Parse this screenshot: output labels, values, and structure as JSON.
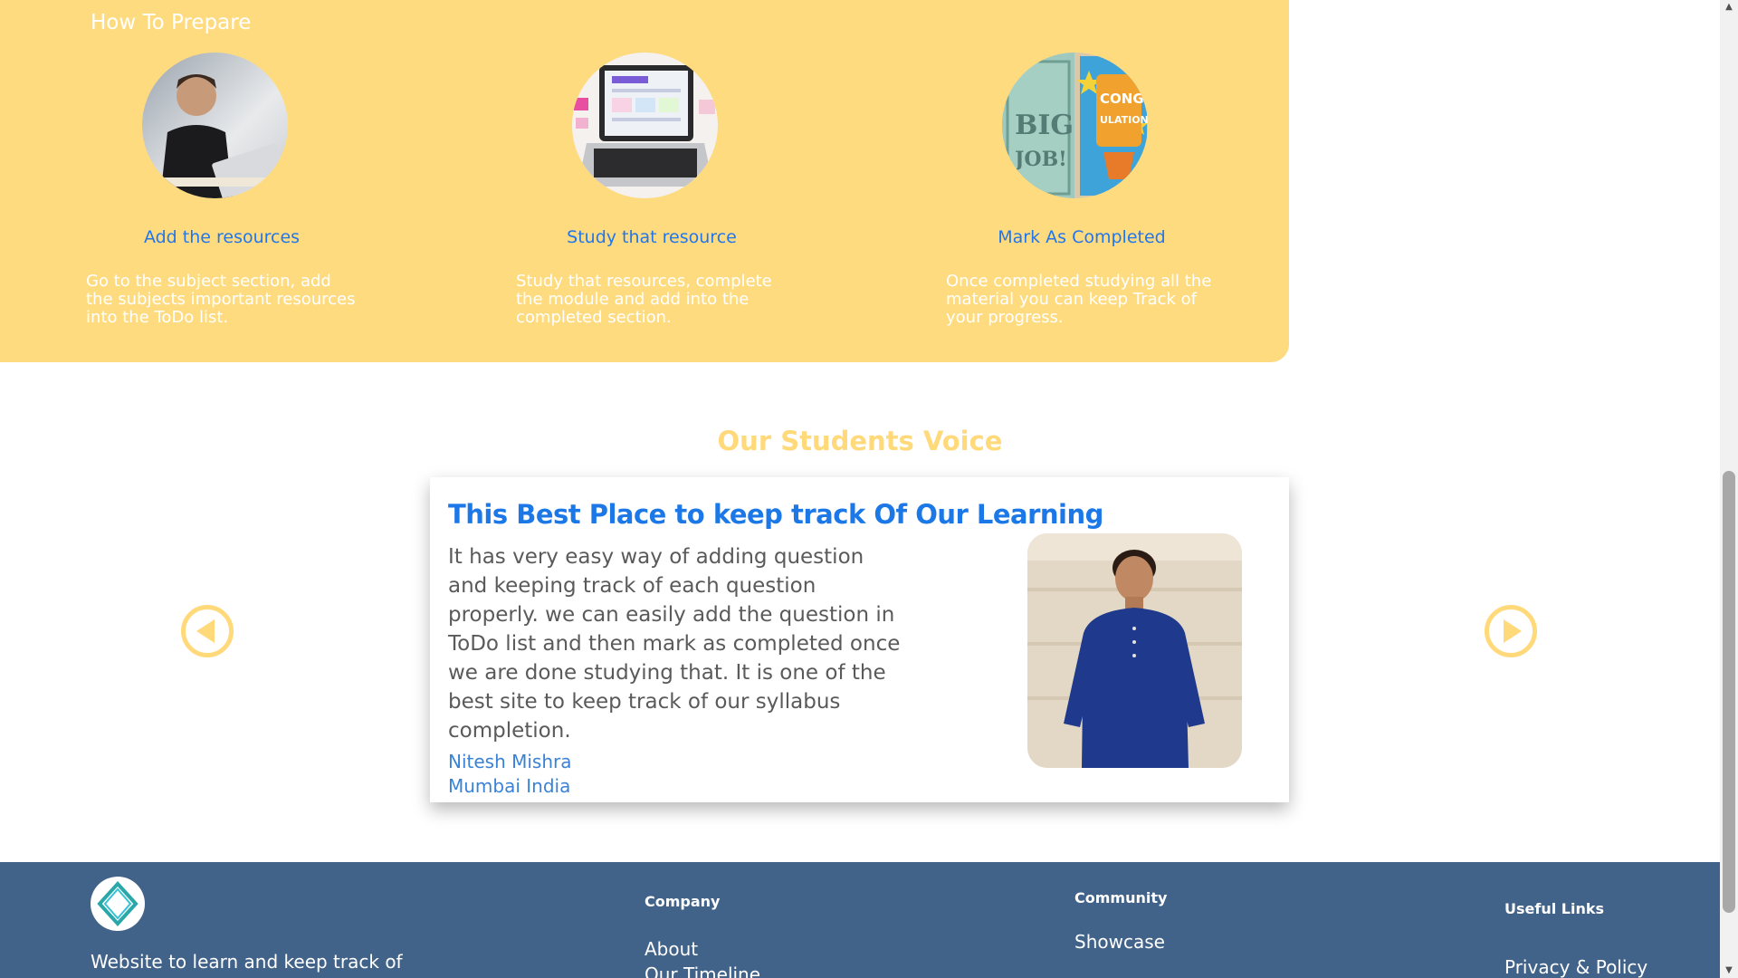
{
  "prepare": {
    "title": "How To Prepare",
    "steps": [
      {
        "title": "Add the resources",
        "text": "Go to the subject section, add the subjects important resources into the ToDo list.",
        "image": "man-with-laptop-photo"
      },
      {
        "title": "Study that resource",
        "text": "Study that resources, complete the module and add into the completed section.",
        "image": "laptop-study-plan-photo"
      },
      {
        "title": "Mark As Completed",
        "text": "Once completed studying all the material you can keep Track of your progress.",
        "image": "congratulations-cards-photo"
      }
    ]
  },
  "voice": {
    "title": "Our Students Voice",
    "card": {
      "heading": "This Best Place to keep track Of Our Learning",
      "body": "It has very easy way of adding question and keeping track of each question properly. we can easily add the question in ToDo list and then mark as completed once we are done studying that. It is one of the best site to keep track of our syllabus completion.",
      "name": "Nitesh Mishra",
      "location": "Mumbai India"
    },
    "prev_icon": "play-left-circle-icon",
    "next_icon": "play-right-circle-icon"
  },
  "footer": {
    "tagline": "Website to learn and keep track of",
    "company": {
      "title": "Company",
      "links": [
        "About",
        "Our Timeline"
      ]
    },
    "community": {
      "title": "Community",
      "links": [
        "Showcase"
      ]
    },
    "useful": {
      "title": "Useful Links",
      "links": [
        "Privacy & Policy"
      ]
    }
  },
  "colors": {
    "panel": "#ffdb80",
    "accent_blue": "#1b78e6",
    "voice_title": "#ffd97a",
    "footer": "#426389"
  }
}
